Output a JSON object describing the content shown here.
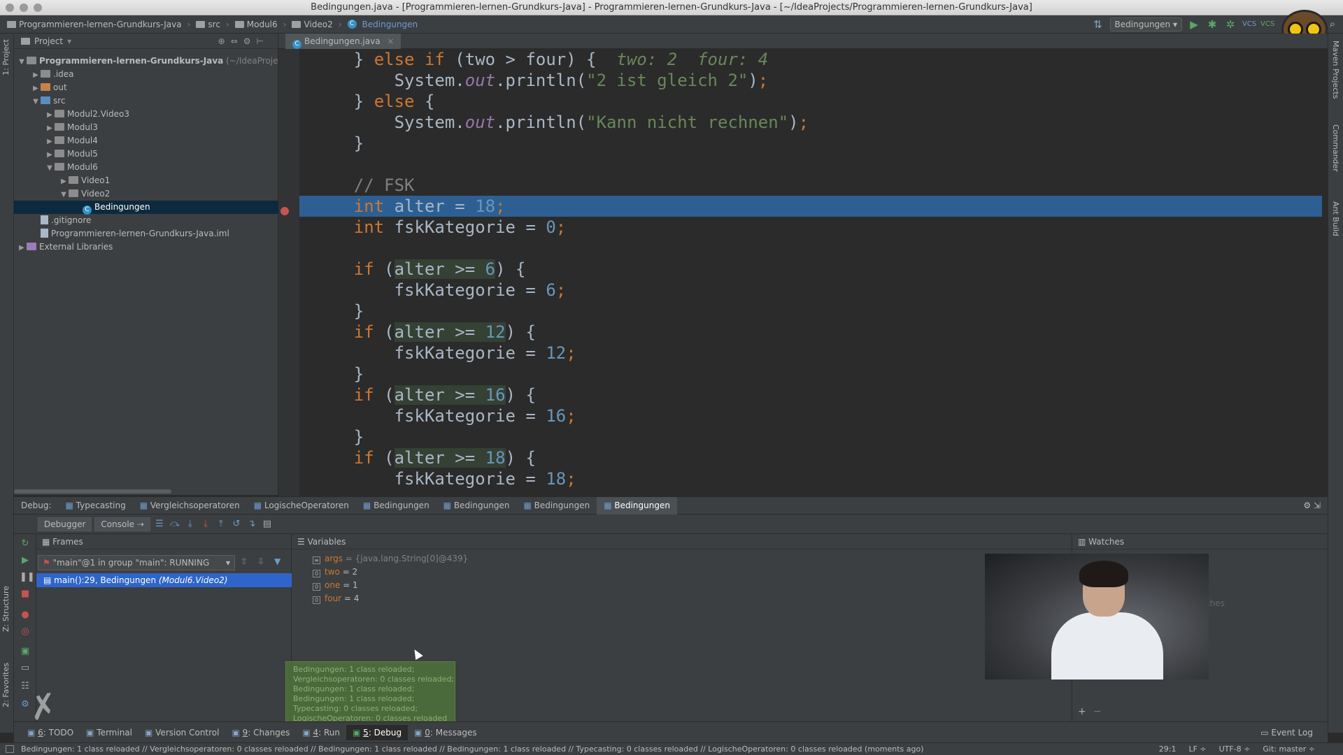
{
  "window": {
    "title": "Bedingungen.java - [Programmieren-lernen-Grundkurs-Java] - Programmieren-lernen-Grundkurs-Java - [~/IdeaProjects/Programmieren-lernen-Grundkurs-Java]"
  },
  "breadcrumb": [
    "Programmieren-lernen-Grundkurs-Java",
    "src",
    "Modul6",
    "Video2",
    "Bedingungen"
  ],
  "run_config": "Bedingungen",
  "left_strip": {
    "project": "1: Project",
    "structure": "Z: Structure",
    "favorites": "2: Favorites"
  },
  "right_strip": {
    "maven": "Maven Projects",
    "commander": "Commander",
    "ant": "Ant Build"
  },
  "project_panel": {
    "header": "Project",
    "tree": [
      {
        "label": "Programmieren-lernen-Grundkurs-Java",
        "suffix": "(~/IdeaProjec",
        "depth": 0,
        "arrow": "▼",
        "icon": "project"
      },
      {
        "label": ".idea",
        "depth": 1,
        "arrow": "▶",
        "icon": "folder"
      },
      {
        "label": "out",
        "depth": 1,
        "arrow": "▶",
        "icon": "folder-orange"
      },
      {
        "label": "src",
        "depth": 1,
        "arrow": "▼",
        "icon": "folder-blue"
      },
      {
        "label": "Modul2.Video3",
        "depth": 2,
        "arrow": "▶",
        "icon": "folder"
      },
      {
        "label": "Modul3",
        "depth": 2,
        "arrow": "▶",
        "icon": "folder"
      },
      {
        "label": "Modul4",
        "depth": 2,
        "arrow": "▶",
        "icon": "folder"
      },
      {
        "label": "Modul5",
        "depth": 2,
        "arrow": "▶",
        "icon": "folder"
      },
      {
        "label": "Modul6",
        "depth": 2,
        "arrow": "▼",
        "icon": "folder"
      },
      {
        "label": "Video1",
        "depth": 3,
        "arrow": "▶",
        "icon": "folder"
      },
      {
        "label": "Video2",
        "depth": 3,
        "arrow": "▼",
        "icon": "folder"
      },
      {
        "label": "Bedingungen",
        "depth": 4,
        "arrow": "",
        "icon": "class",
        "selected": true
      },
      {
        "label": ".gitignore",
        "depth": 1,
        "arrow": "",
        "icon": "file"
      },
      {
        "label": "Programmieren-lernen-Grundkurs-Java.iml",
        "depth": 1,
        "arrow": "",
        "icon": "file"
      },
      {
        "label": "External Libraries",
        "depth": 0,
        "arrow": "▶",
        "icon": "library"
      }
    ]
  },
  "editor": {
    "tab": "Bedingungen.java",
    "lines": [
      [
        {
          "t": "    } "
        },
        {
          "t": "else if",
          "c": "kw"
        },
        {
          "t": " (two > four) {  "
        },
        {
          "t": "two: 2  four: 4",
          "c": "inl"
        }
      ],
      [
        {
          "t": "        System."
        },
        {
          "t": "out",
          "c": "fld"
        },
        {
          "t": ".println("
        },
        {
          "t": "\"2 ist gleich 2\"",
          "c": "str"
        },
        {
          "t": ")"
        },
        {
          "t": ";",
          "c": "semi"
        }
      ],
      [
        {
          "t": "    } "
        },
        {
          "t": "else",
          "c": "kw"
        },
        {
          "t": " {"
        }
      ],
      [
        {
          "t": "        System."
        },
        {
          "t": "out",
          "c": "fld"
        },
        {
          "t": ".println("
        },
        {
          "t": "\"Kann nicht rechnen\"",
          "c": "str"
        },
        {
          "t": ")"
        },
        {
          "t": ";",
          "c": "semi"
        }
      ],
      [
        {
          "t": "    }"
        }
      ],
      [
        {
          "t": ""
        }
      ],
      [
        {
          "t": "    // FSK",
          "c": "cmt"
        }
      ],
      [
        {
          "t": "    "
        },
        {
          "t": "int",
          "c": "kw"
        },
        {
          "t": " alter = "
        },
        {
          "t": "18",
          "c": "num"
        },
        {
          "t": ";",
          "c": "semi"
        }
      ],
      [
        {
          "t": "    "
        },
        {
          "t": "int",
          "c": "kw"
        },
        {
          "t": " fskKategorie = "
        },
        {
          "t": "0",
          "c": "num"
        },
        {
          "t": ";",
          "c": "semi"
        }
      ],
      [
        {
          "t": ""
        }
      ],
      [
        {
          "t": "    "
        },
        {
          "t": "if",
          "c": "kw"
        },
        {
          "t": " ("
        },
        {
          "t": "alter >= ",
          "c": "hv"
        },
        {
          "t": "6",
          "c": "num hv"
        },
        {
          "t": ") {"
        }
      ],
      [
        {
          "t": "        fskKategorie = "
        },
        {
          "t": "6",
          "c": "num"
        },
        {
          "t": ";",
          "c": "semi"
        }
      ],
      [
        {
          "t": "    }"
        }
      ],
      [
        {
          "t": "    "
        },
        {
          "t": "if",
          "c": "kw"
        },
        {
          "t": " ("
        },
        {
          "t": "alter >= ",
          "c": "hv"
        },
        {
          "t": "12",
          "c": "num hv"
        },
        {
          "t": ") {"
        }
      ],
      [
        {
          "t": "        fskKategorie = "
        },
        {
          "t": "12",
          "c": "num"
        },
        {
          "t": ";",
          "c": "semi"
        }
      ],
      [
        {
          "t": "    }"
        }
      ],
      [
        {
          "t": "    "
        },
        {
          "t": "if",
          "c": "kw"
        },
        {
          "t": " ("
        },
        {
          "t": "alter >= ",
          "c": "hv"
        },
        {
          "t": "16",
          "c": "num hv"
        },
        {
          "t": ") {"
        }
      ],
      [
        {
          "t": "        fskKategorie = "
        },
        {
          "t": "16",
          "c": "num"
        },
        {
          "t": ";",
          "c": "semi"
        }
      ],
      [
        {
          "t": "    }"
        }
      ],
      [
        {
          "t": "    "
        },
        {
          "t": "if",
          "c": "kw"
        },
        {
          "t": " ("
        },
        {
          "t": "alter >= ",
          "c": "hv"
        },
        {
          "t": "18",
          "c": "num hv"
        },
        {
          "t": ") {"
        }
      ],
      [
        {
          "t": "        fskKategorie = "
        },
        {
          "t": "18",
          "c": "num"
        },
        {
          "t": ";",
          "c": "semi"
        }
      ]
    ],
    "highlighted_line": 7
  },
  "debug": {
    "label": "Debug:",
    "tabs": [
      "Typecasting",
      "Vergleichsoperatoren",
      "LogischeOperatoren",
      "Bedingungen",
      "Bedingungen",
      "Bedingungen",
      "Bedingungen"
    ],
    "active_tab": 6,
    "debugger_tab": "Debugger",
    "console_tab": "Console",
    "frames_title": "Frames",
    "thread": "\"main\"@1 in group \"main\": RUNNING",
    "frame": "main():29, Bedingungen",
    "frame_pkg": "(Modul6.Video2)",
    "variables_title": "Variables",
    "variables": [
      {
        "name": "args",
        "value": " = {java.lang.String[0]@439}"
      },
      {
        "name": "two",
        "value": " = 2"
      },
      {
        "name": "one",
        "value": " = 1"
      },
      {
        "name": "four",
        "value": " = 4"
      }
    ],
    "watches_title": "Watches",
    "watches_partial": "ches"
  },
  "toast": [
    "Bedingungen: 1 class reloaded;",
    "Vergleichsoperatoren: 0 classes reloaded;",
    "Bedingungen: 1 class reloaded;",
    "Bedingungen: 1 class reloaded;",
    "Typecasting: 0 classes reloaded;",
    "LogischeOperatoren: 0 classes reloaded"
  ],
  "tool_windows": [
    {
      "key": "6",
      "label": "TODO"
    },
    {
      "key": "",
      "label": "Terminal"
    },
    {
      "key": "",
      "label": "Version Control"
    },
    {
      "key": "9",
      "label": "Changes"
    },
    {
      "key": "4",
      "label": "Run"
    },
    {
      "key": "5",
      "label": "Debug",
      "active": true
    },
    {
      "key": "0",
      "label": "Messages"
    }
  ],
  "event_log": "Event Log",
  "status": {
    "message": "Bedingungen: 1 class reloaded // Vergleichsoperatoren: 0 classes reloaded // Bedingungen: 1 class reloaded // Bedingungen: 1 class reloaded // Typecasting: 0 classes reloaded // LogischeOperatoren: 0 classes reloaded (moments ago)",
    "position": "29:1",
    "line_sep": "LF ÷",
    "encoding": "UTF-8 ÷",
    "vcs": "Git: master ÷"
  }
}
